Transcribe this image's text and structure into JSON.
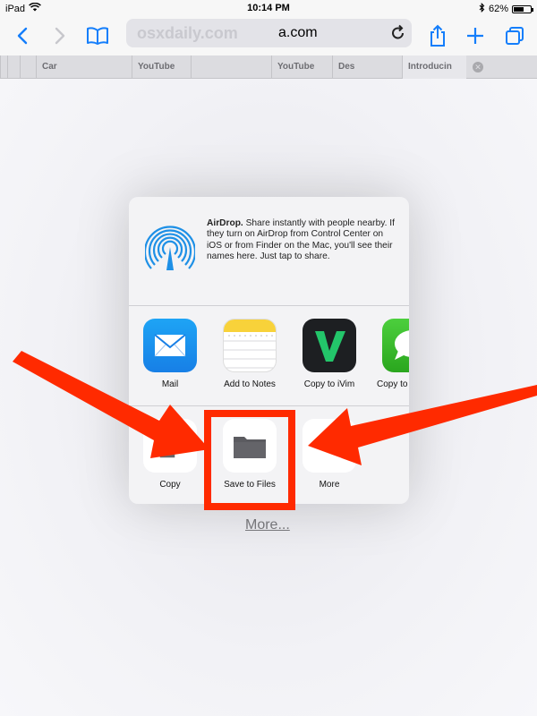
{
  "status_bar": {
    "device": "iPad",
    "time": "10:14 PM",
    "battery": "62%",
    "battery_level": 0.62
  },
  "nav": {
    "address_watermark": "osxdaily.com",
    "address_text": "a.com"
  },
  "tabs": [
    {
      "label": ""
    },
    {
      "label": ""
    },
    {
      "label": "Car"
    },
    {
      "label": "YouTube"
    },
    {
      "label": ""
    },
    {
      "label": "YouTube"
    },
    {
      "label": "Des"
    },
    {
      "label": "Introducin"
    }
  ],
  "share_sheet": {
    "airdrop_title": "AirDrop.",
    "airdrop_desc": "Share instantly with people nearby. If they turn on AirDrop from Control Center on iOS or from Finder on the Mac, you'll see their names here. Just tap to share.",
    "apps": [
      {
        "label": "Mail",
        "icon": "mail-icon"
      },
      {
        "label": "Add to Notes",
        "icon": "notes-icon"
      },
      {
        "label": "Copy to iVim",
        "icon": "ivim-icon"
      },
      {
        "label": "Copy to",
        "icon": "messages-icon"
      }
    ],
    "actions": [
      {
        "label": "Copy",
        "icon": "copy-icon"
      },
      {
        "label": "Save to Files",
        "icon": "folder-icon"
      },
      {
        "label": "More",
        "icon": "more-icon"
      }
    ]
  },
  "page": {
    "more_link": "More..."
  },
  "colors": {
    "accent": "#147efb",
    "annotation": "#ff2a00"
  }
}
